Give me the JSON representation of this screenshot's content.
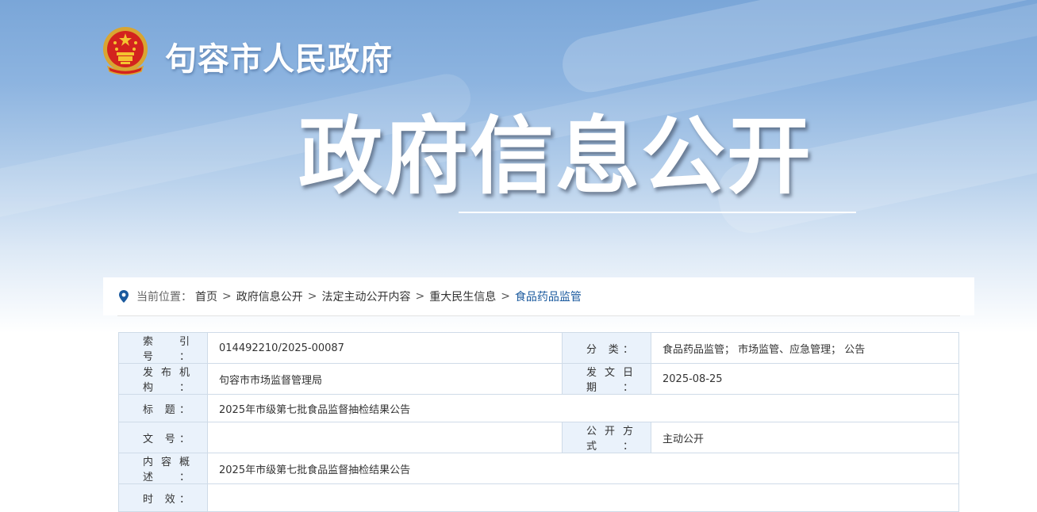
{
  "header": {
    "site_name": "句容市人民政府",
    "section_title": "政府信息公开"
  },
  "breadcrumb": {
    "label": "当前位置：",
    "items": [
      "首页",
      "政府信息公开",
      "法定主动公开内容",
      "重大民生信息"
    ],
    "current": "食品药品监管",
    "separator": ">"
  },
  "meta": {
    "index_label": "索 引 号：",
    "index_value": "014492210/2025-00087",
    "category_label": "分 类：",
    "category_value": "食品药品监管； 市场监管、应急管理； 公告",
    "publisher_label": "发布机构：",
    "publisher_value": "句容市市场监督管理局",
    "date_label": "发文日期：",
    "date_value": "2025-08-25",
    "title_label": "标 题：",
    "title_value": "2025年市级第七批食品监督抽检结果公告",
    "docno_label": "文 号：",
    "docno_value": "",
    "method_label": "公开方式：",
    "method_value": "主动公开",
    "summary_label": "内容概述：",
    "summary_value": "2025年市级第七批食品监督抽检结果公告",
    "validity_label": "时 效：",
    "validity_value": ""
  },
  "icons": {
    "emblem": "national-emblem-icon",
    "location": "location-pin-icon"
  },
  "colors": {
    "banner_top": "#7aa6d8",
    "label_bg": "#eaf2fb",
    "border": "#cfdbe8",
    "current_crumb": "#1b5a9e",
    "pin": "#1b5a9e"
  }
}
